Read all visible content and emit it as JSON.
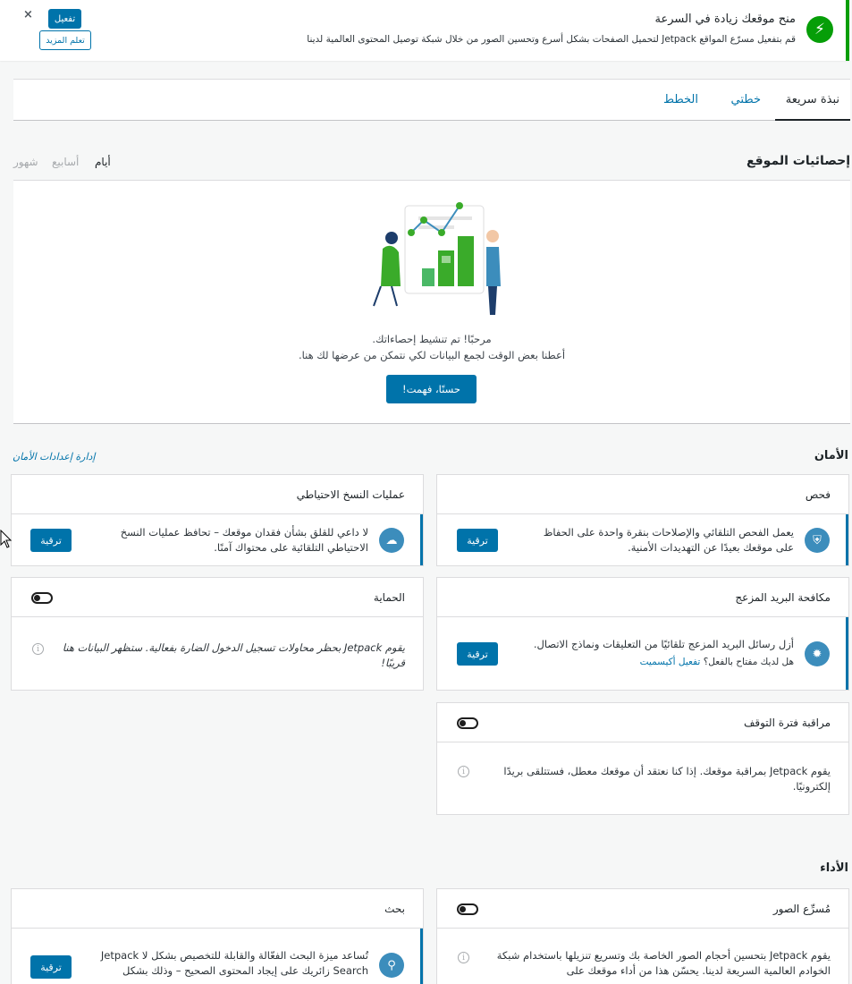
{
  "notice": {
    "title": "منح موقعك زيادة في السرعة",
    "description": "قم بتفعيل مسرّع المواقع Jetpack لتحميل الصفحات بشكل أسرع وتحسين الصور من خلال شبكة توصيل المحتوى العالمية لدينا",
    "activate_label": "تفعيل",
    "learn_more_label": "تعلم المزيد",
    "close_glyph": "×",
    "icon_glyph": "⚡"
  },
  "tabs": [
    {
      "label": "نبذة سريعة",
      "active": true
    },
    {
      "label": "خطتي",
      "active": false
    },
    {
      "label": "الخطط",
      "active": false
    }
  ],
  "stats": {
    "title": "إحصائيات الموقع",
    "periods": {
      "days": "أيام",
      "weeks": "أسابيع",
      "months": "شهور"
    },
    "message_line1": "مرحبًا! تم تنشيط إحصاءاتك.",
    "message_line2": "أعطنا بعض الوقت لجمع البيانات لكي نتمكن من عرضها لك هنا.",
    "got_it_label": "حسنًا، فهمت!"
  },
  "security": {
    "title": "الأمان",
    "manage_link": "إدارة إعدادات الأمان",
    "scan": {
      "title": "فحص",
      "text": "يعمل الفحص التلقائي والإصلاحات بنقرة واحدة على الحفاظ على موقعك بعيدًا عن التهديدات الأمنية.",
      "upgrade_label": "ترقية"
    },
    "backups": {
      "title": "عمليات النسخ الاحتياطي",
      "text": "لا داعي للقلق بشأن فقدان موقعك – تحافظ عمليات النسخ الاحتياطي التلقائية على محتواك آمنًا.",
      "upgrade_label": "ترقية"
    },
    "antispam": {
      "title": "مكافحة البريد المزعج",
      "text": "أزل رسائل البريد المزعج تلقائيًا من التعليقات ونماذج الاتصال.",
      "key_question": "هل لديك مفتاح بالفعل؟",
      "activate_link": "تفعيل أكيسميت",
      "upgrade_label": "ترقية"
    },
    "protect": {
      "title": "الحماية",
      "text": "يقوم Jetpack بحظر محاولات تسجيل الدخول الضارة بفعالية. ستظهر البيانات هنا قريبًا!"
    },
    "downtime": {
      "title": "مراقبة فترة التوقف",
      "text": "يقوم Jetpack بمراقبة موقعك. إذا كنا نعتقد أن موقعك معطل، فستتلقى بريدًا إلكترونيًا."
    }
  },
  "performance": {
    "title": "الأداء",
    "image_cdn": {
      "title": "مُسرِّع الصور",
      "text": "يقوم Jetpack بتحسين أحجام الصور الخاصة بك وتسريع تنزيلها باستخدام شبكة الخوادم العالمية السريعة لدينا. يحسّن هذا من أداء موقعك على"
    },
    "search": {
      "title": "بحث",
      "text": "تُساعد ميزة البحث الفعّالة والقابلة للتخصيص بشكل لا Jetpack Search زائريك على إيجاد المحتوى الصحيح – وذلك بشكل",
      "upgrade_label": "ترقية"
    }
  },
  "colors": {
    "accent": "#0073aa",
    "jetpack_green": "#069e08"
  }
}
